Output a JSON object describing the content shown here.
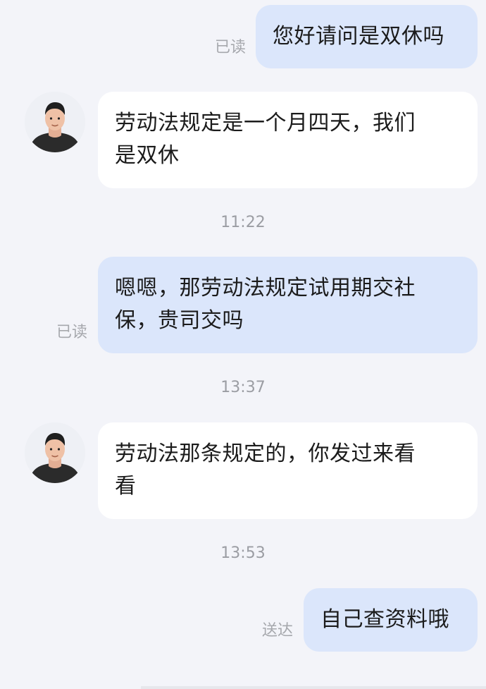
{
  "messages": [
    {
      "from": "me",
      "text": "您好请问是双休吗",
      "status": "已读"
    },
    {
      "from": "them",
      "text_lines": [
        "劳动法规定是一个月四天，我们",
        "是双休"
      ]
    },
    {
      "time": "11:22"
    },
    {
      "from": "me",
      "text_lines": [
        "嗯嗯，那劳动法规定试用期交社",
        "保，贵司交吗"
      ],
      "status": "已读"
    },
    {
      "time": "13:37"
    },
    {
      "from": "them",
      "text_lines": [
        "劳动法那条规定的，你发过来看",
        "看"
      ]
    },
    {
      "time": "13:53"
    },
    {
      "from": "me",
      "text": "自己查资料哦",
      "status": "送达"
    }
  ],
  "colors": {
    "background": "#f3f4f9",
    "my_bubble": "#dbe6fb",
    "their_bubble": "#ffffff",
    "status_text": "#a6a8ad"
  },
  "icons": {
    "avatar": "avatar-icon"
  }
}
